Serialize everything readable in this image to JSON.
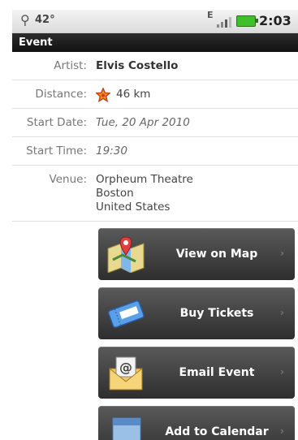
{
  "status": {
    "temperature": "42°",
    "network": "E",
    "time": "2:03"
  },
  "title": "Event",
  "fields": {
    "artist": {
      "label": "Artist:",
      "value": "Elvis Costello"
    },
    "distance": {
      "label": "Distance:",
      "value": "46 km"
    },
    "start_date": {
      "label": "Start Date:",
      "value": "Tue, 20 Apr 2010"
    },
    "start_time": {
      "label": "Start Time:",
      "value": "19:30"
    },
    "venue": {
      "label": "Venue:",
      "line1": "Orpheum Theatre",
      "line2": "Boston",
      "line3": "United States"
    }
  },
  "actions": {
    "view_map": "View on Map",
    "buy_tickets": "Buy Tickets",
    "email_event": "Email Event",
    "add_calendar": "Add to Calendar"
  },
  "icons": {
    "distance": "star-icon",
    "map": "map-pin-icon",
    "tickets": "ticket-icon",
    "email": "envelope-icon",
    "calendar": "calendar-icon"
  }
}
